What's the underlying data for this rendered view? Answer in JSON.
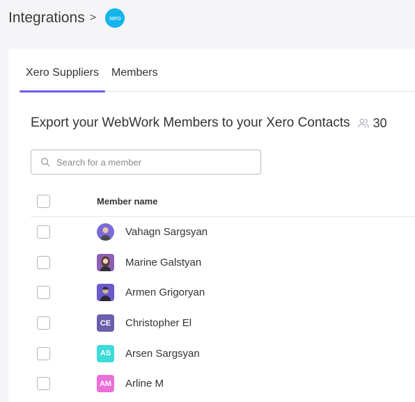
{
  "breadcrumb": {
    "title": "Integrations",
    "separator": ">",
    "logo_text": "xero"
  },
  "tabs": [
    {
      "label": "Xero Suppliers",
      "active": true
    },
    {
      "label": "Members",
      "active": false
    }
  ],
  "heading": {
    "text": "Export your WebWork Members to your Xero Contacts",
    "count_icon": "users-icon",
    "count": "30"
  },
  "search": {
    "placeholder": "Search for a member",
    "icon": "search-icon"
  },
  "table": {
    "column_header": "Member name",
    "rows": [
      {
        "name": "Vahagn Sargsyan",
        "avatar_type": "photo",
        "initials": "",
        "color": "#7a6bd8"
      },
      {
        "name": "Marine Galstyan",
        "avatar_type": "photo",
        "initials": "",
        "color": "#8e5fb3"
      },
      {
        "name": "Armen Grigoryan",
        "avatar_type": "photo",
        "initials": "",
        "color": "#6a5acd"
      },
      {
        "name": "Christopher El",
        "avatar_type": "initials",
        "initials": "CE",
        "color": "#6a5fad"
      },
      {
        "name": "Arsen Sargsyan",
        "avatar_type": "initials",
        "initials": "AS",
        "color": "#3ddbd9"
      },
      {
        "name": "Arline M",
        "avatar_type": "initials",
        "initials": "AM",
        "color": "#ec6fd9"
      }
    ]
  },
  "colors": {
    "accent": "#6c5ce7",
    "xero_brand": "#13b5ea"
  }
}
